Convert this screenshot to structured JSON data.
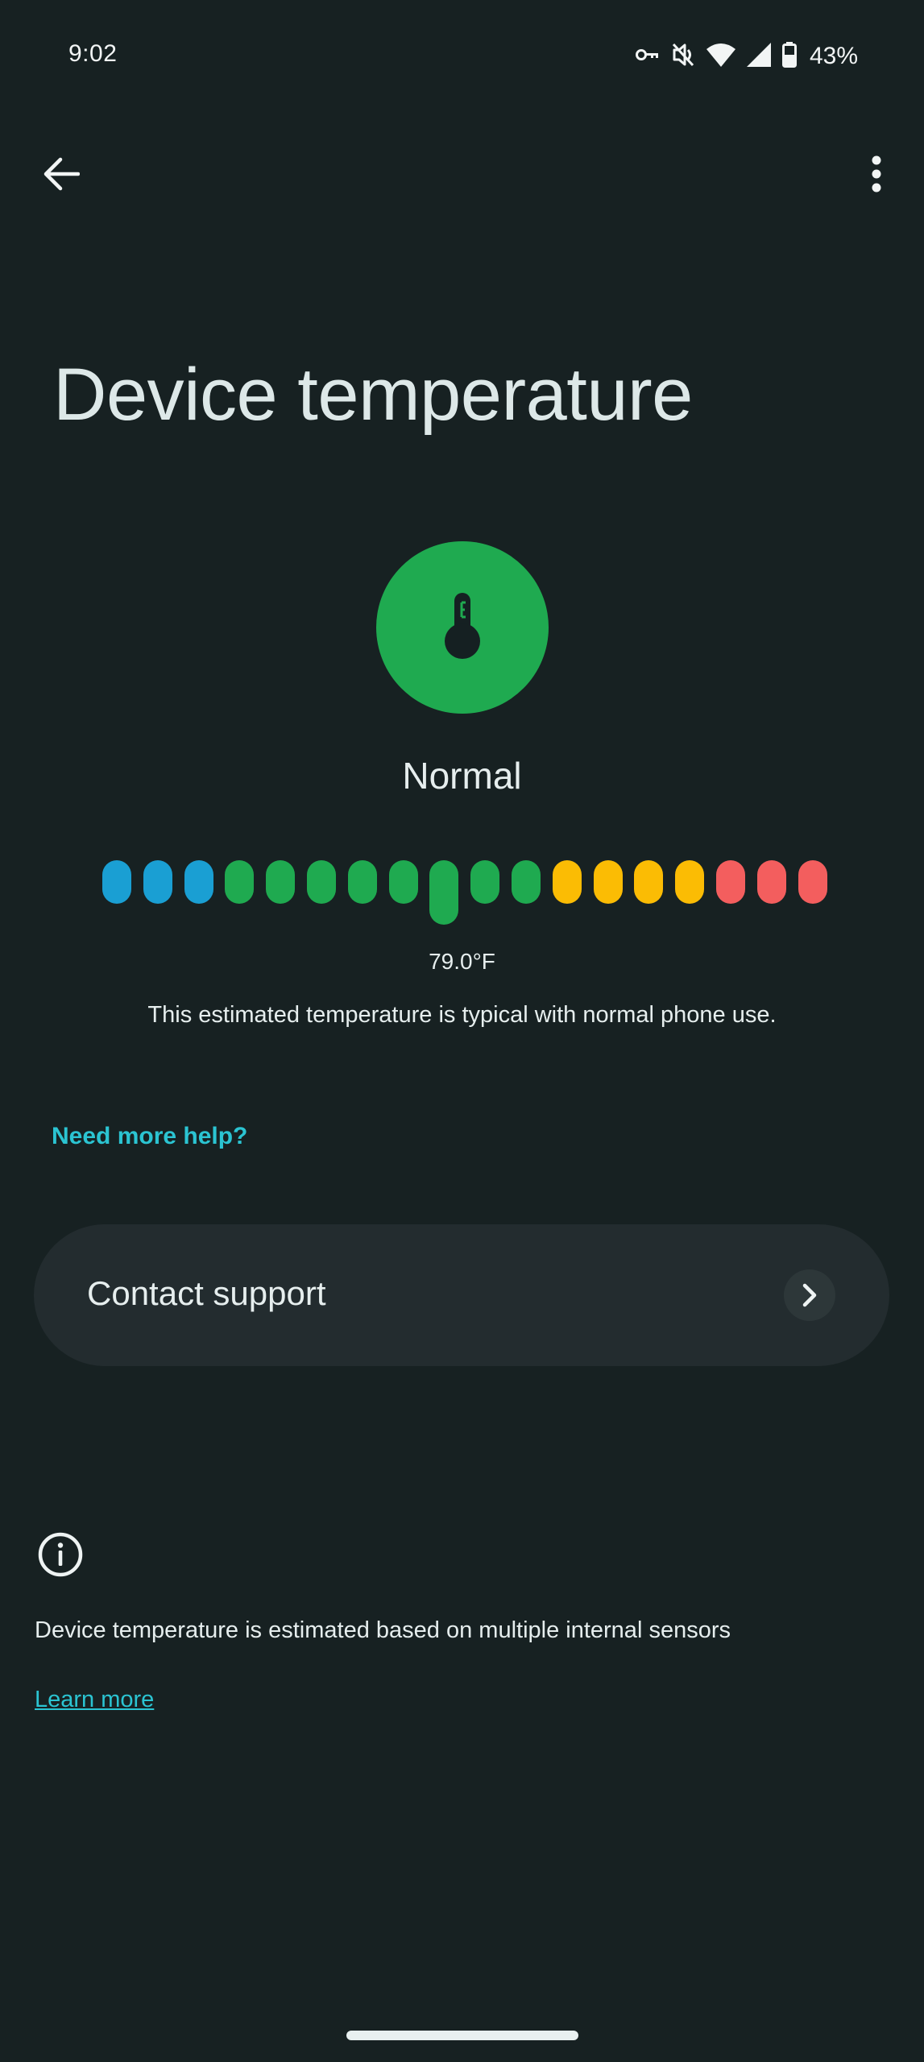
{
  "status_bar": {
    "time": "9:02",
    "icons": [
      "vpn-key-icon",
      "vibrate-off-icon",
      "wifi-icon",
      "cell-signal-icon",
      "battery-icon"
    ],
    "battery_percent": "43%"
  },
  "app_bar": {
    "back_icon": "arrow-left-icon",
    "more_icon": "more-vertical-icon"
  },
  "page": {
    "title": "Device temperature",
    "status": "Normal",
    "status_color": "#1faa50",
    "temperature": "79.0°F",
    "description": "This estimated temperature is typical with normal phone use."
  },
  "gauge": {
    "segments": [
      "#1a9fd3",
      "#1a9fd3",
      "#1a9fd3",
      "#1faa50",
      "#1faa50",
      "#1faa50",
      "#1faa50",
      "#1faa50",
      "#1faa50",
      "#1faa50",
      "#1faa50",
      "#fbbc04",
      "#fbbc04",
      "#fbbc04",
      "#fbbc04",
      "#f35e5e",
      "#f35e5e",
      "#f35e5e"
    ],
    "current_index": 8,
    "segment_count": 18
  },
  "help": {
    "heading": "Need more help?",
    "contact_label": "Contact support"
  },
  "footer": {
    "info_text": "Device temperature is estimated based on multiple internal sensors",
    "learn_more": "Learn more"
  },
  "colors": {
    "background": "#172122",
    "accent": "#2bc4d2",
    "card": "#232c2f"
  }
}
